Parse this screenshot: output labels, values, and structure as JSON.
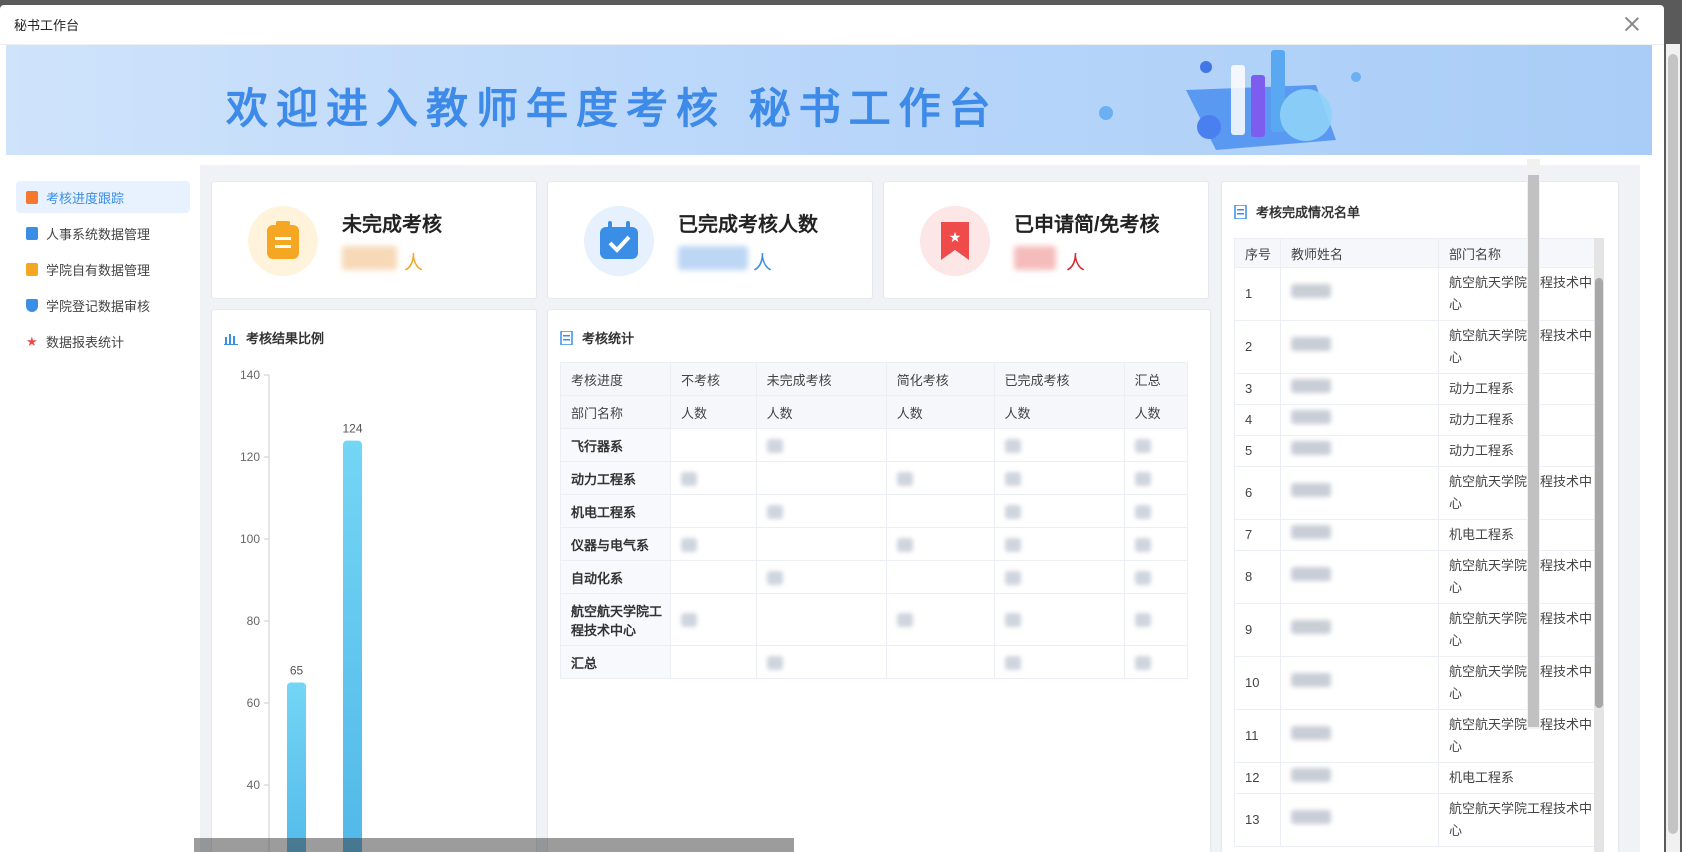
{
  "window": {
    "title": "秘书工作台"
  },
  "banner": {
    "title": "欢迎进入教师年度考核 秘书工作台"
  },
  "sidebar": {
    "items": [
      {
        "label": "考核进度跟踪",
        "icon": "clipboard-orange-icon",
        "color": "#f5772b",
        "active": true
      },
      {
        "label": "人事系统数据管理",
        "icon": "document-blue-icon",
        "color": "#3a8ee6",
        "active": false
      },
      {
        "label": "学院自有数据管理",
        "icon": "document-orange-icon",
        "color": "#f5a623",
        "active": false
      },
      {
        "label": "学院登记数据审核",
        "icon": "shield-blue-icon",
        "color": "#3a8ee6",
        "active": false
      },
      {
        "label": "数据报表统计",
        "icon": "star-red-icon",
        "color": "#ef4b4b",
        "active": false
      }
    ]
  },
  "stats": [
    {
      "label": "未完成考核",
      "unit": "人",
      "color": "#f5a623",
      "bg": "#fff3dc"
    },
    {
      "label": "已完成考核人数",
      "unit": "人",
      "color": "#3a8ee6",
      "bg": "#e6f1fd"
    },
    {
      "label": "已申请简/免考核",
      "unit": "人",
      "color": "#d9272e",
      "bg": "#fde6e6"
    }
  ],
  "result_chart": {
    "title": "考核结果比例",
    "chart_data": {
      "type": "bar",
      "values": [
        65,
        124
      ],
      "ylim": [
        40,
        140
      ],
      "yticks": [
        140,
        120,
        100,
        80,
        60,
        40
      ],
      "grid": false
    }
  },
  "stat_table": {
    "title": "考核统计",
    "header1": [
      "考核进度",
      "不考核",
      "未完成考核",
      "简化考核",
      "已完成考核",
      "汇总"
    ],
    "header2": [
      "部门名称",
      "人数",
      "人数",
      "人数",
      "人数",
      "人数"
    ],
    "rows": [
      [
        "飞行器系",
        "",
        "",
        "",
        "",
        ""
      ],
      [
        "动力工程系",
        "",
        "",
        "",
        "",
        ""
      ],
      [
        "机电工程系",
        "",
        "",
        "",
        "",
        ""
      ],
      [
        "仪器与电气系",
        "",
        "",
        "",
        "",
        ""
      ],
      [
        "自动化系",
        "",
        "",
        "",
        "",
        ""
      ],
      [
        "航空航天学院工程技术中心",
        "",
        "",
        "",
        "",
        ""
      ],
      [
        "汇总",
        "",
        "",
        "",
        "",
        ""
      ]
    ]
  },
  "list_table": {
    "title": "考核完成情况名单",
    "headers": [
      "序号",
      "教师姓名",
      "部门名称"
    ],
    "rows": [
      {
        "no": "1",
        "dept": "航空航天学院工程技术中心"
      },
      {
        "no": "2",
        "dept": "航空航天学院工程技术中心"
      },
      {
        "no": "3",
        "dept": "动力工程系"
      },
      {
        "no": "4",
        "dept": "动力工程系"
      },
      {
        "no": "5",
        "dept": "动力工程系"
      },
      {
        "no": "6",
        "dept": "航空航天学院工程技术中心"
      },
      {
        "no": "7",
        "dept": "机电工程系"
      },
      {
        "no": "8",
        "dept": "航空航天学院工程技术中心"
      },
      {
        "no": "9",
        "dept": "航空航天学院工程技术中心"
      },
      {
        "no": "10",
        "dept": "航空航天学院工程技术中心"
      },
      {
        "no": "11",
        "dept": "航空航天学院工程技术中心"
      },
      {
        "no": "12",
        "dept": "机电工程系"
      },
      {
        "no": "13",
        "dept": "航空航天学院工程技术中心"
      }
    ]
  }
}
